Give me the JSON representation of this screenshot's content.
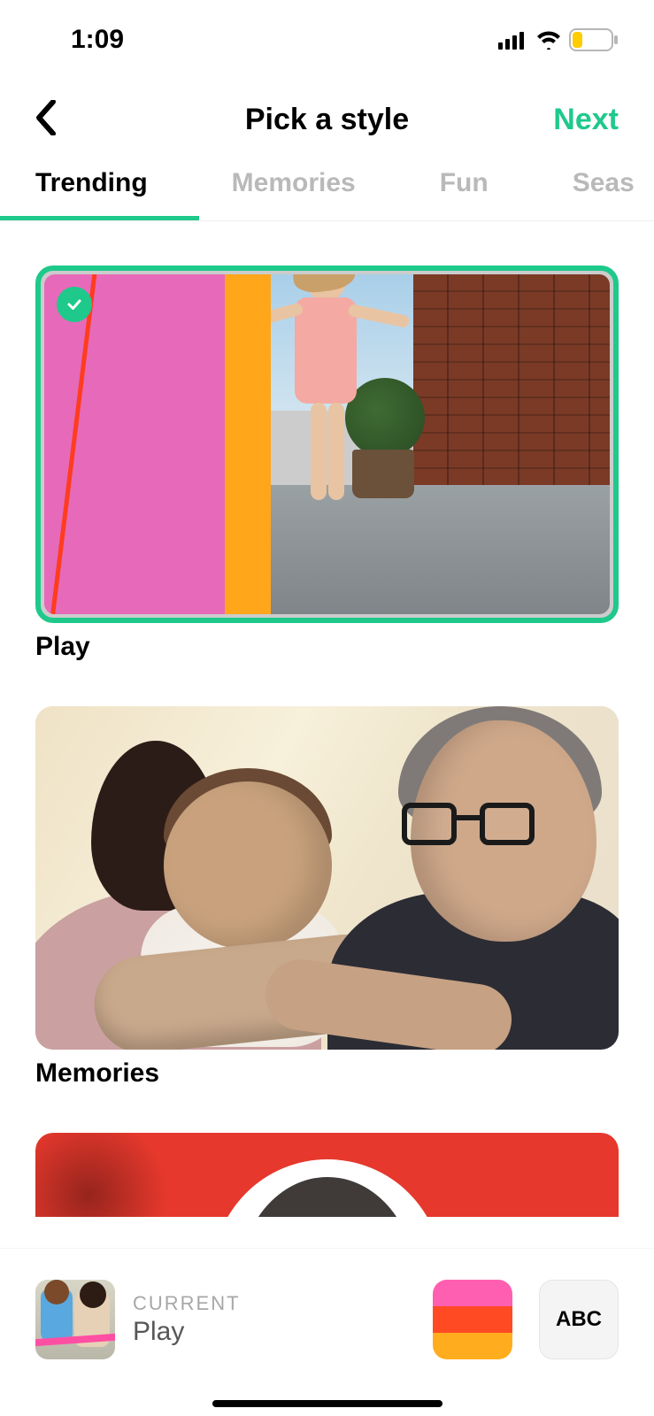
{
  "status": {
    "time": "1:09"
  },
  "nav": {
    "title": "Pick a style",
    "next": "Next"
  },
  "tabs": [
    "Trending",
    "Memories",
    "Fun",
    "Seas"
  ],
  "active_tab_index": 0,
  "styles": [
    {
      "label": "Play",
      "selected": true
    },
    {
      "label": "Memories",
      "selected": false
    }
  ],
  "bottom": {
    "current_label": "CURRENT",
    "current_style": "Play",
    "abc": "ABC",
    "swatch": [
      "#ff5fb0",
      "#ff4a24",
      "#ffad1f"
    ]
  }
}
